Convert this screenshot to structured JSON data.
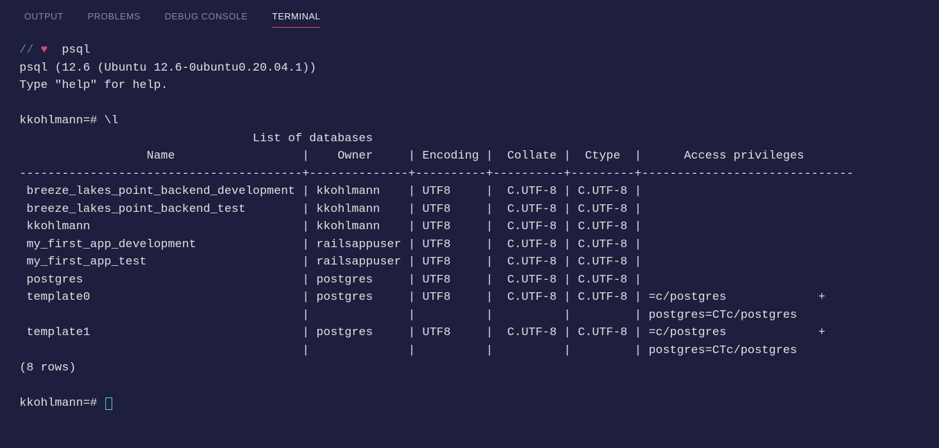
{
  "tabs": {
    "output": "OUTPUT",
    "problems": "PROBLEMS",
    "debug_console": "DEBUG CONSOLE",
    "terminal": "TERMINAL"
  },
  "prompt": {
    "slashes": "//",
    "heart": "♥",
    "cmd_psql": "psql"
  },
  "lines": {
    "version": "psql (12.6 (Ubuntu 12.6-0ubuntu0.20.04.1))",
    "help": "Type \"help\" for help.",
    "blank": "",
    "prompt1": "kkohlmann=# \\l",
    "title": "                                 List of databases                                                                     ",
    "headers": "                  Name                  |    Owner     | Encoding |  Collate |  Ctype  |      Access privileges        ",
    "sep": "----------------------------------------+--------------+----------+----------+---------+------------------------------",
    "r1": " breeze_lakes_point_backend_development | kkohlmann    | UTF8     |  C.UTF-8 | C.UTF-8 |                              ",
    "r2": " breeze_lakes_point_backend_test        | kkohlmann    | UTF8     |  C.UTF-8 | C.UTF-8 |                              ",
    "r3": " kkohlmann                              | kkohlmann    | UTF8     |  C.UTF-8 | C.UTF-8 |                              ",
    "r4": " my_first_app_development               | railsappuser | UTF8     |  C.UTF-8 | C.UTF-8 |                              ",
    "r5": " my_first_app_test                      | railsappuser | UTF8     |  C.UTF-8 | C.UTF-8 |                              ",
    "r6": " postgres                               | postgres     | UTF8     |  C.UTF-8 | C.UTF-8 |                              ",
    "r7": " template0                              | postgres     | UTF8     |  C.UTF-8 | C.UTF-8 | =c/postgres             +",
    "r7b": "                                        |              |          |          |         | postgres=CTc/postgres",
    "r8": " template1                              | postgres     | UTF8     |  C.UTF-8 | C.UTF-8 | =c/postgres             +",
    "r8b": "                                        |              |          |          |         | postgres=CTc/postgres",
    "rowcount": "(8 rows)",
    "prompt2": "kkohlmann=# "
  }
}
